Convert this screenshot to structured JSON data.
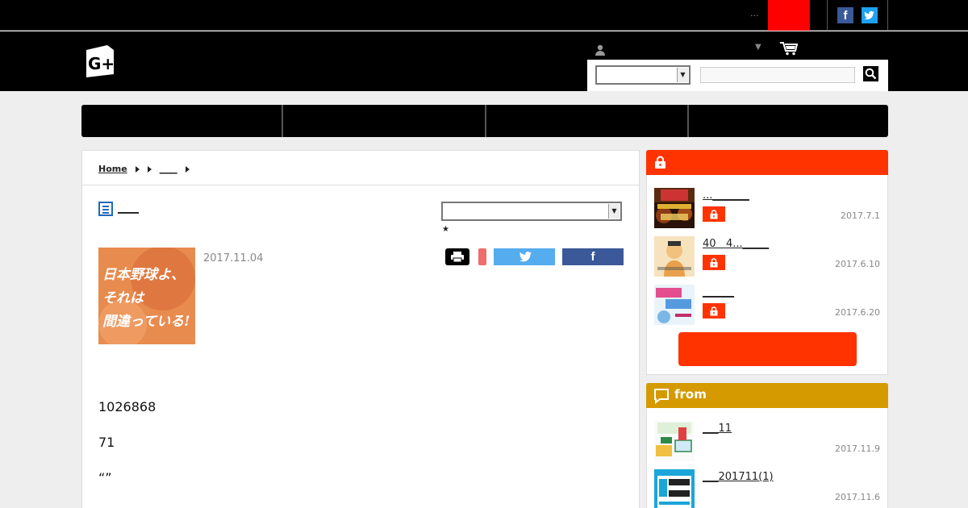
{
  "topbar": {
    "dots": "...",
    "facebook_glyph": "f",
    "twitter_glyph": "t"
  },
  "header": {
    "logo_text": "G+",
    "user_caret": "▼",
    "search_placeholder": ""
  },
  "breadcrumb": {
    "home": "Home",
    "item2": "",
    "item3": "____"
  },
  "article": {
    "category_title": "____",
    "sort_star": "★",
    "thumb_lines": [
      "日本野球よ、",
      "それは",
      "間違っている!"
    ],
    "date": "2017.11.04",
    "fb_label": "f",
    "body": [
      "1026868",
      "71",
      "“”"
    ]
  },
  "sidebar": {
    "locked": {
      "items": [
        {
          "title": "..._______",
          "date": "2017.7.1"
        },
        {
          "title": "40   4..._____",
          "date": "2017.6.10"
        },
        {
          "title": "______",
          "date": "2017.6.20"
        }
      ]
    },
    "from": {
      "title": "from",
      "items": [
        {
          "title": "___11",
          "date": "2017.11.9"
        },
        {
          "title": "___201711(1)",
          "date": "2017.11.6"
        }
      ]
    }
  },
  "colors": {
    "accent_red": "#ff3300",
    "topbar_red": "#ff0000",
    "from_gold": "#d59a00",
    "facebook": "#3b5998",
    "twitter": "#55acee"
  }
}
